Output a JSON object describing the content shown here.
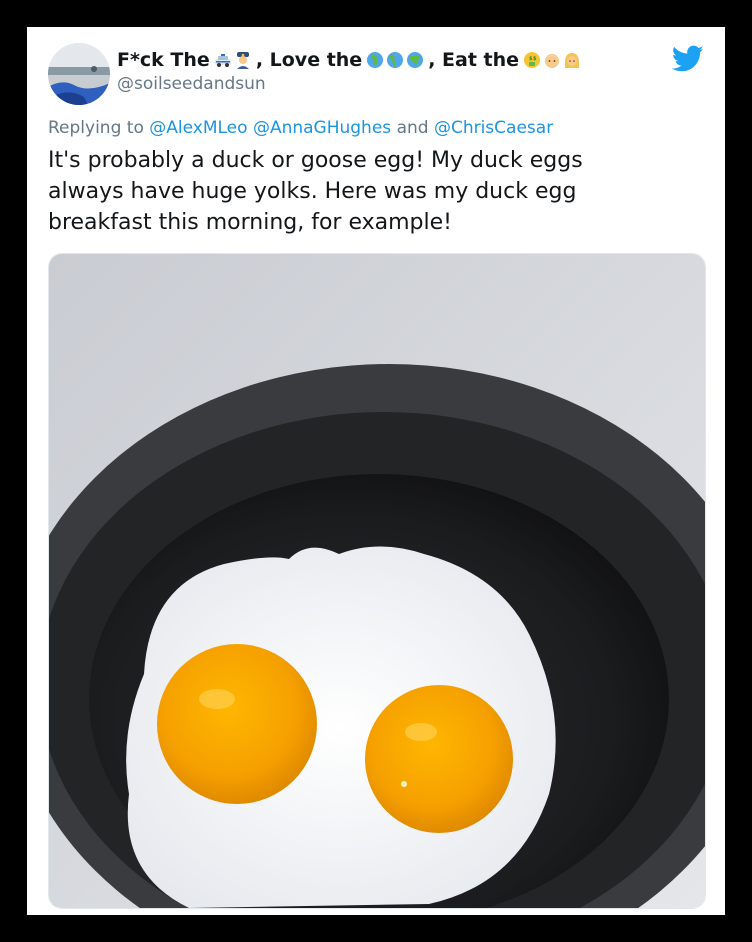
{
  "tweet": {
    "author": {
      "name_segments": {
        "part1": "F*ck The",
        "part2": ", Love the",
        "part3": ", Eat the"
      },
      "emojis": {
        "group1": [
          "police-car-emoji",
          "police-officer-emoji"
        ],
        "group2": [
          "globe-africa-emoji",
          "globe-americas-emoji",
          "globe-asia-emoji"
        ],
        "group3": [
          "money-mouth-face-emoji",
          "older-person-emoji",
          "person-blond-emoji"
        ]
      },
      "handle": "@soilseedandsun",
      "avatar_icon": "beach-landscape-avatar"
    },
    "reply": {
      "prefix": "Replying to",
      "mention1": "@AlexMLeo",
      "mention2": "@AnnaGHughes",
      "connector": "and",
      "mention3": "@ChrisCaesar"
    },
    "text_lines": [
      "It's probably a duck or goose egg! My duck eggs",
      "always have huge yolks. Here was my duck egg",
      "breakfast this morning, for example!"
    ],
    "media": {
      "description_icon": "photo-fried-duck-eggs-in-pan"
    },
    "logo_icon": "twitter-bird-icon"
  },
  "colors": {
    "background": "#000000",
    "card": "#ffffff",
    "text_primary": "#14171a",
    "text_secondary": "#657786",
    "link": "#1b95e0",
    "twitter_blue": "#1da1f2"
  }
}
